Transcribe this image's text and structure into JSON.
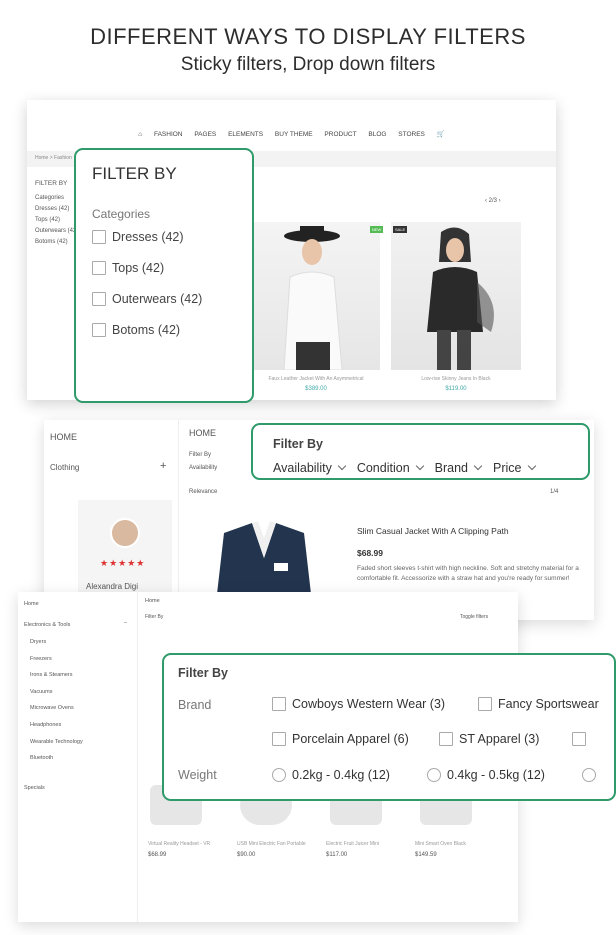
{
  "heading": "DIFFERENT WAYS TO DISPLAY FILTERS",
  "subheading": "Sticky filters, Drop down filters",
  "panel1": {
    "nav": [
      "FASHION",
      "PAGES",
      "ELEMENTS",
      "BUY THEME",
      "PRODUCT",
      "BLOG",
      "STORES"
    ],
    "breadcrumb": "Home > Fashion",
    "side_title": "FILTER BY",
    "side_categories": "Categories",
    "side_items": [
      "Dresses (42)",
      "Tops (42)",
      "Outerwears (42)",
      "Botoms (42)"
    ],
    "pager": "2/3",
    "products": [
      {
        "badge": "NEW",
        "name": "Faux Leather Jacket With An Asymmetrical",
        "price": "$389.00"
      },
      {
        "badge": "SALE",
        "name": "Low-rise Skinny Jeans In Black",
        "price": "$119.00"
      }
    ]
  },
  "overlay1": {
    "title": "FILTER BY",
    "subtitle": "Categories",
    "items": [
      "Dresses (42)",
      "Tops (42)",
      "Outerwears (42)",
      "Botoms (42)"
    ]
  },
  "panel2": {
    "home": "HOME",
    "crumb": "HOME",
    "category": "Clothing",
    "plus": "+",
    "filter_by": "Filter By",
    "availability": "Availability",
    "relevance": "Relevance",
    "pager": "1/4",
    "product_title": "Slim Casual Jacket With A Clipping Path",
    "product_price": "$68.99",
    "product_desc": "Faded short sleeves t-shirt with high neckline. Soft and stretchy material for a comfortable fit. Accessorize with a straw hat and you're ready for summer!",
    "reviewer": "Alexandra Digi",
    "stars": "★★★★★"
  },
  "overlay2": {
    "title": "Filter By",
    "filters": [
      "Availability",
      "Condition",
      "Brand",
      "Price"
    ]
  },
  "panel3": {
    "home": "Home",
    "category": "Electronics & Tools",
    "subcats": [
      "Dryers",
      "Freezers",
      "Irons & Steamers",
      "Vacuums",
      "Microwave Ovens",
      "Headphones",
      "Wearable Technology",
      "Bluetooth"
    ],
    "specials": "Specials",
    "crumb": "Home",
    "filter_by": "Filter By",
    "toggle": "Toggle filters",
    "products": [
      {
        "name": "Virtual Reality Headset - VR",
        "price": "$68.99"
      },
      {
        "name": "USB Mini Electric Fan Portable",
        "price": "$90.00"
      },
      {
        "name": "Electric Fruit Juicer Mini",
        "price": "$117.00"
      },
      {
        "name": "Mini Smart Oven Black",
        "price": "$149.59"
      }
    ]
  },
  "overlay3": {
    "title": "Filter By",
    "brand_label": "Brand",
    "weight_label": "Weight",
    "brands": [
      "Cowboys Western Wear (3)",
      "Fancy Sportswear",
      "Porcelain Apparel (6)",
      "ST Apparel (3)"
    ],
    "weights": [
      "0.2kg - 0.4kg (12)",
      "0.4kg - 0.5kg (12)"
    ]
  },
  "colors": {
    "accent": "#2f9a6a",
    "price": "#44aaaa"
  }
}
